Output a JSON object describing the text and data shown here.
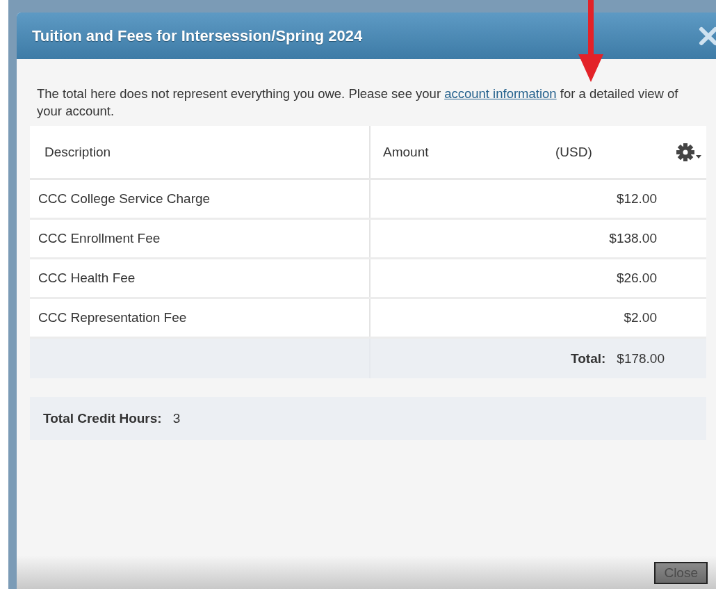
{
  "dialog": {
    "title": "Tuition and Fees for Intersession/Spring 2024",
    "notice": {
      "before": "The total here does not represent everything you owe. Please see your",
      "link": "account information",
      "after": "for a detailed view of your account."
    },
    "table": {
      "columns": [
        "Description",
        "Amount",
        "(USD)"
      ],
      "rows": [
        {
          "description": "CCC College Service Charge",
          "amount": "$12.00"
        },
        {
          "description": "CCC Enrollment Fee",
          "amount": "$138.00"
        },
        {
          "description": "CCC Health Fee",
          "amount": "$26.00"
        },
        {
          "description": "CCC Representation Fee",
          "amount": "$2.00"
        }
      ],
      "total_label": "Total:",
      "total": "$178.00"
    },
    "credit_hours": {
      "label": "Total Credit Hours:",
      "value": "3"
    },
    "buttons": [
      "Close"
    ]
  }
}
